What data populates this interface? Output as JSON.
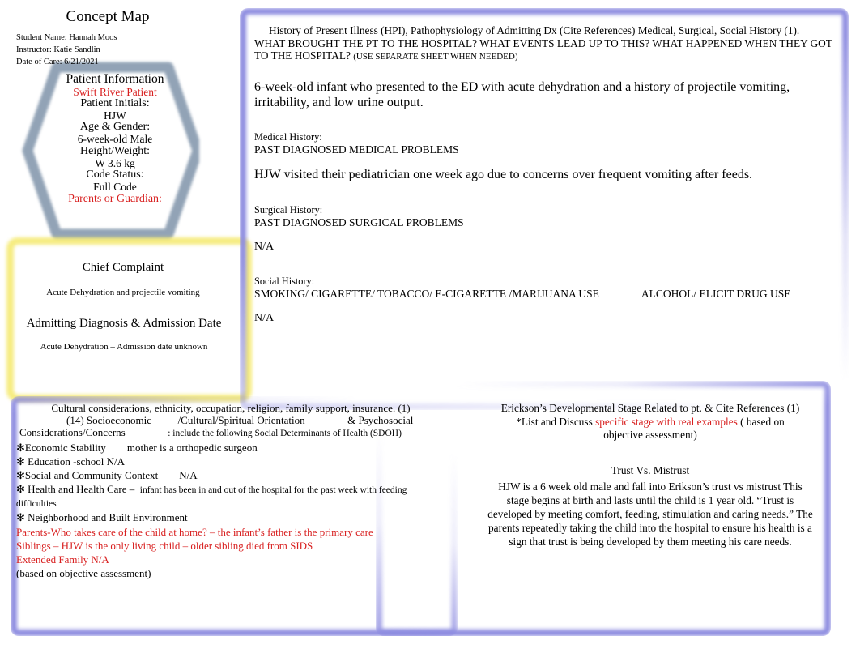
{
  "document": {
    "title": "Concept Map",
    "student_name": "Student Name: Hannah Moos",
    "instructor": "Instructor: Katie Sandlin",
    "date_of_care": "Date of Care: 6/21/2021"
  },
  "colors": {
    "accent_red": "#d81f1f",
    "border_purple": "#8d8ce0",
    "border_yellow": "#f5e96a",
    "hexagon_gray": "#8d9fb3"
  },
  "patient_information": {
    "heading": "Patient Information",
    "source_label": "Swift River Patient",
    "fields": [
      {
        "label": "Patient Initials:",
        "value": "HJW"
      },
      {
        "label": "Age & Gender:",
        "value": "6-week-old Male"
      },
      {
        "label": "Height/Weight:",
        "value": "W 3.6 kg"
      },
      {
        "label": "Code Status:",
        "value": "Full Code"
      }
    ],
    "guardian_label": "Parents or Guardian:"
  },
  "chief_complaint": {
    "heading": "Chief Complaint",
    "body": "Acute Dehydration and projectile vomiting"
  },
  "admitting_diagnosis": {
    "heading": "Admitting Diagnosis & Admission Date",
    "body": "Acute Dehydration – Admission date unknown"
  },
  "hpi": {
    "prompt_line1": "History of Present Illness (HPI), Pathophysiology of Admitting Dx (Cite References) Medical, Surgical, Social History (1).",
    "prompt_line2": "WHAT BROUGHT THE PT TO THE HOSPITAL?  WHAT EVENTS LEAD UP TO THIS? WHAT HAPPENED WHEN THEY GOT",
    "prompt_line3": "TO THE HOSPITAL?",
    "prompt_note": "(USE SEPARATE SHEET WHEN NEEDED)",
    "body": "6-week-old infant who presented to the ED with acute dehydration and a history of projectile vomiting, irritability, and low urine output.",
    "medical_history": {
      "label": "Medical History:",
      "prompt": "PAST DIAGNOSED MEDICAL PROBLEMS",
      "body": "HJW visited their pediatrician one week ago due to concerns over frequent vomiting after feeds."
    },
    "surgical_history": {
      "label": "Surgical History:",
      "prompt": "PAST DIAGNOSED SURGICAL PROBLEMS",
      "body": "N/A"
    },
    "social_history": {
      "label": "Social History:",
      "prompt_a": "SMOKING/ CIGARETTE/ TOBACCO/ E-CIGARETTE /MARIJUANA USE",
      "prompt_b": "ALCOHOL/ ELICIT DRUG USE",
      "body": "N/A"
    }
  },
  "cultural": {
    "line1": "Cultural considerations, ethnicity, occupation, religion, family support, insurance. (1)",
    "line2_a": "(14) Socioeconomic",
    "line2_b": "/Cultural/Spiritual Orientation",
    "line2_c": "& Psychosocial",
    "line3_a": "Considerations/Concerns",
    "line3_b": ": include the following Social Determinants of Health (SDOH)",
    "bullet_glyph": "✻",
    "items": [
      {
        "label": "Economic Stability",
        "value": "mother is a orthopedic surgeon"
      },
      {
        "label": "Education -school N/A",
        "value": ""
      },
      {
        "label": "Social and Community Context",
        "value": "N/A"
      },
      {
        "label": "Health and Health Care –",
        "value": "infant has been in and out of the hospital for the past week with feeding difficulties"
      },
      {
        "label": "Neighborhood and Built Environment",
        "value": ""
      }
    ],
    "red_lines": [
      "Parents-Who takes care of the child at home? – the infant’s father is the primary care",
      "Siblings – HJW is the only living child – older sibling died from SIDS",
      "Extended Family N/A"
    ],
    "footer": "(based on objective assessment)"
  },
  "erickson": {
    "head_line1": "Erickson’s Developmental Stage Related to pt. & Cite References (1)",
    "head_line2_a": "*List and Discuss",
    "head_line2_red": "specific  stage with real examples",
    "head_line2_b": "( based on",
    "head_line3": "objective assessment)",
    "stage": "Trust Vs. Mistrust",
    "body": "HJW is a 6 week old male and fall into Erikson’s trust vs mistrust This stage begins at birth and lasts until the child is 1 year old. “Trust is developed by meeting comfort, feeding, stimulation and caring needs.” The parents repeatedly taking the child into the hospital to ensure his health is a sign that trust is being developed by them meeting his care needs."
  }
}
